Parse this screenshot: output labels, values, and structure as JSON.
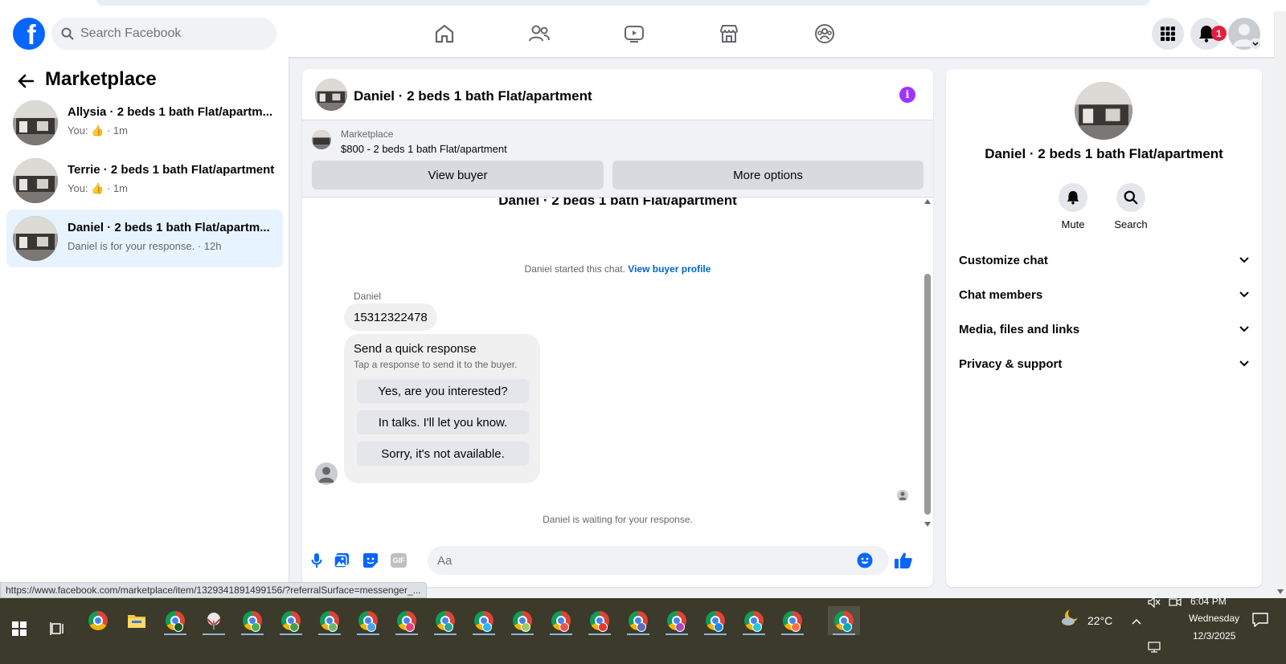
{
  "header": {
    "search_placeholder": "Search Facebook",
    "notification_count": "1",
    "brand_color": "#0866ff"
  },
  "sidebar": {
    "title": "Marketplace",
    "threads": [
      {
        "name": "Allysia · 2 beds 1 bath Flat/apartm...",
        "preview": "You:  · 1m",
        "active": false
      },
      {
        "name": "Terrie · 2 beds 1 bath Flat/apartment",
        "preview": "You:  · 1m",
        "active": false
      },
      {
        "name": "Daniel · 2 beds 1 bath Flat/apartm...",
        "preview": "Daniel is for your response. · 12h",
        "active": true
      }
    ]
  },
  "chat": {
    "title": "Daniel · 2 beds 1 bath Flat/apartment",
    "listing_source": "Marketplace",
    "listing_price": "$800 - 2 beds 1 bath Flat/apartment",
    "view_buyer": "View buyer",
    "more_options": "More options",
    "cut_title": "Daniel · 2 beds 1 bath Flat/apartment",
    "started_text": "Daniel started this chat.",
    "view_buyer_profile": "View buyer profile",
    "sender": "Daniel",
    "message": "15312322478",
    "quick_title": "Send a quick response",
    "quick_sub": "Tap a response to send it to the buyer.",
    "quick_replies": [
      "Yes, are you interested?",
      "In talks. I'll let you know.",
      "Sorry, it's not available."
    ],
    "waiting": "Daniel is waiting for your response.",
    "input_placeholder": "Aa",
    "gif_label": "GIF"
  },
  "info": {
    "name": "Daniel · 2 beds 1 bath Flat/apartment",
    "mute": "Mute",
    "search": "Search",
    "sections": [
      "Customize chat",
      "Chat members",
      "Media, files and links",
      "Privacy & support"
    ]
  },
  "status_url": "https://www.facebook.com/marketplace/item/1329341891499156/?referralSurface=messenger_...",
  "taskbar": {
    "weather": "22°C",
    "time": "6:04 PM",
    "day": "Wednesday",
    "date": "12/3/2025"
  }
}
